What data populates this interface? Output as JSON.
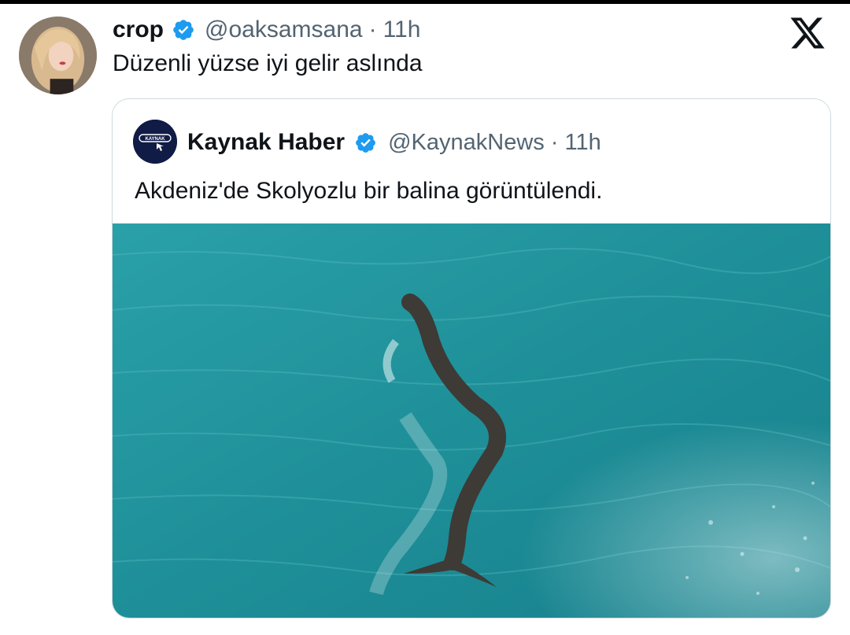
{
  "tweet": {
    "author_name": "crop",
    "handle": "@oaksamsana",
    "separator": "·",
    "time": "11h",
    "text": "Düzenli yüzse iyi gelir aslında"
  },
  "quoted_tweet": {
    "author_name": "Kaynak Haber",
    "handle": "@KaynakNews",
    "separator": "·",
    "time": "11h",
    "text": "Akdeniz'de Skolyozlu bir balina görüntülendi.",
    "avatar_logo_text": "KAYNAK"
  },
  "colors": {
    "verified_badge": "#1d9bf0",
    "secondary_text": "#536471",
    "sea": "#1f8f97",
    "card_border": "#cfd9de"
  },
  "icons": {
    "brand": "x-logo-icon",
    "verified": "verified-badge-icon"
  }
}
